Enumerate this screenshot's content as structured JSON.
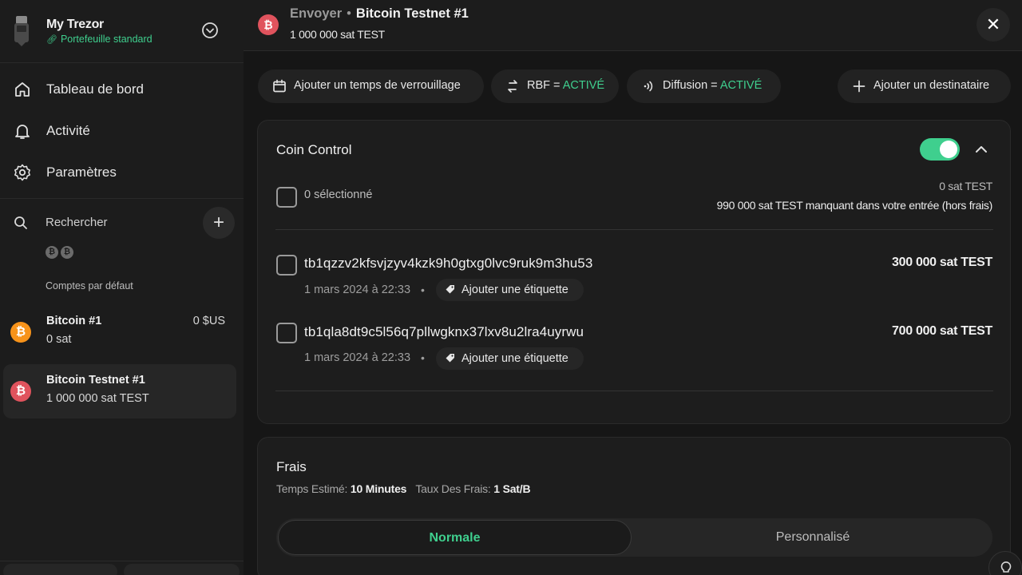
{
  "sidebar": {
    "wallet_name": "My Trezor",
    "wallet_type": "Portefeuille standard",
    "nav": [
      {
        "label": "Tableau de bord",
        "icon": "home-icon"
      },
      {
        "label": "Activité",
        "icon": "bell-icon"
      },
      {
        "label": "Paramètres",
        "icon": "gear-icon"
      }
    ],
    "search_label": "Rechercher",
    "coin_badges": [
      "₿",
      "₿"
    ],
    "accounts_title": "Comptes par défaut",
    "accounts": [
      {
        "name": "Bitcoin #1",
        "balance": "0 sat",
        "fiat": "0 $US",
        "color": "#f7931a",
        "symbol": "₿"
      },
      {
        "name": "Bitcoin Testnet #1",
        "balance": "1 000 000 sat TEST",
        "fiat": "",
        "color": "#e0535d",
        "symbol": "₿"
      }
    ]
  },
  "topbar": {
    "action": "Envoyer",
    "account": "Bitcoin Testnet #1",
    "balance": "1 000 000 sat TEST"
  },
  "options": {
    "locktime_label": "Ajouter un temps de verrouillage",
    "rbf_label": "RBF = ",
    "rbf_state": "ACTIVÉ",
    "broadcast_label": "Diffusion = ",
    "broadcast_state": "ACTIVÉ",
    "add_recipient_label": "Ajouter un destinataire"
  },
  "coin_control": {
    "title": "Coin Control",
    "enabled": true,
    "selected_label": "0 sélectionné",
    "selected_amount": "0 sat TEST",
    "missing_text": "990 000 sat TEST manquant dans votre entrée (hors frais)",
    "utxos": [
      {
        "address": "tb1qzzv2kfsvjzyv4kzk9h0gtxg0lvc9ruk9m3hu53",
        "amount": "300 000 sat TEST",
        "date": "1 mars 2024 à 22:33",
        "label_action": "Ajouter une étiquette"
      },
      {
        "address": "tb1qla8dt9c5l56q7pllwgknx37lxv8u2lra4uyrwu",
        "amount": "700 000 sat TEST",
        "date": "1 mars 2024 à 22:33",
        "label_action": "Ajouter une étiquette"
      }
    ]
  },
  "fees": {
    "title": "Frais",
    "est_time_label": "Temps Estimé:",
    "est_time_value": "10 Minutes",
    "rate_label": "Taux Des Frais:",
    "rate_value": "1 Sat/B",
    "options": [
      "Normale",
      "Personnalisé"
    ],
    "selected": "Normale"
  },
  "colors": {
    "accent": "#3fcf8e",
    "testnet": "#e0535d",
    "bitcoin": "#f7931a"
  }
}
